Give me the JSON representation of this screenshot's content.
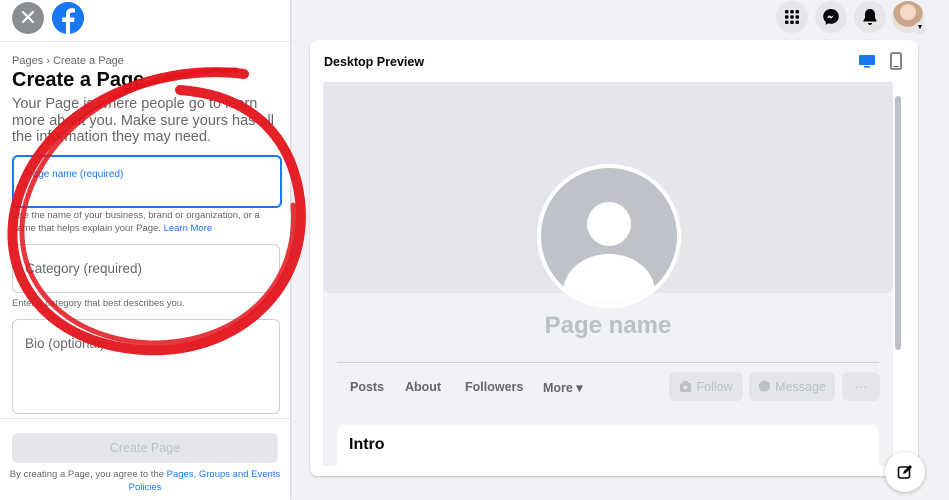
{
  "left": {
    "breadcrumb": "Pages › Create a Page",
    "title": "Create a Page",
    "description": "Your Page is where people go to learn more about you. Make sure yours has all the information they may need.",
    "page_name_label": "Page name (required)",
    "page_name_value": "",
    "page_name_helper": "Use the name of your business, brand or organization, or a name that helps explain your Page.",
    "learn_more": "Learn More",
    "category_placeholder": "Category (required)",
    "category_helper": "Enter a category that best describes you.",
    "bio_placeholder": "Bio (optional)",
    "create_button": "Create Page",
    "terms_prefix": "By creating a Page, you agree to the",
    "terms_link": "Pages, Groups and Events Policies"
  },
  "preview": {
    "title": "Desktop Preview",
    "page_name": "Page name",
    "tabs": [
      "Posts",
      "About",
      "Followers",
      "More ▾"
    ],
    "follow": "Follow",
    "message": "Message",
    "more_dots": "···",
    "intro": "Intro"
  },
  "colors": {
    "accent": "#1877f2",
    "annotation": "#e3141c"
  }
}
